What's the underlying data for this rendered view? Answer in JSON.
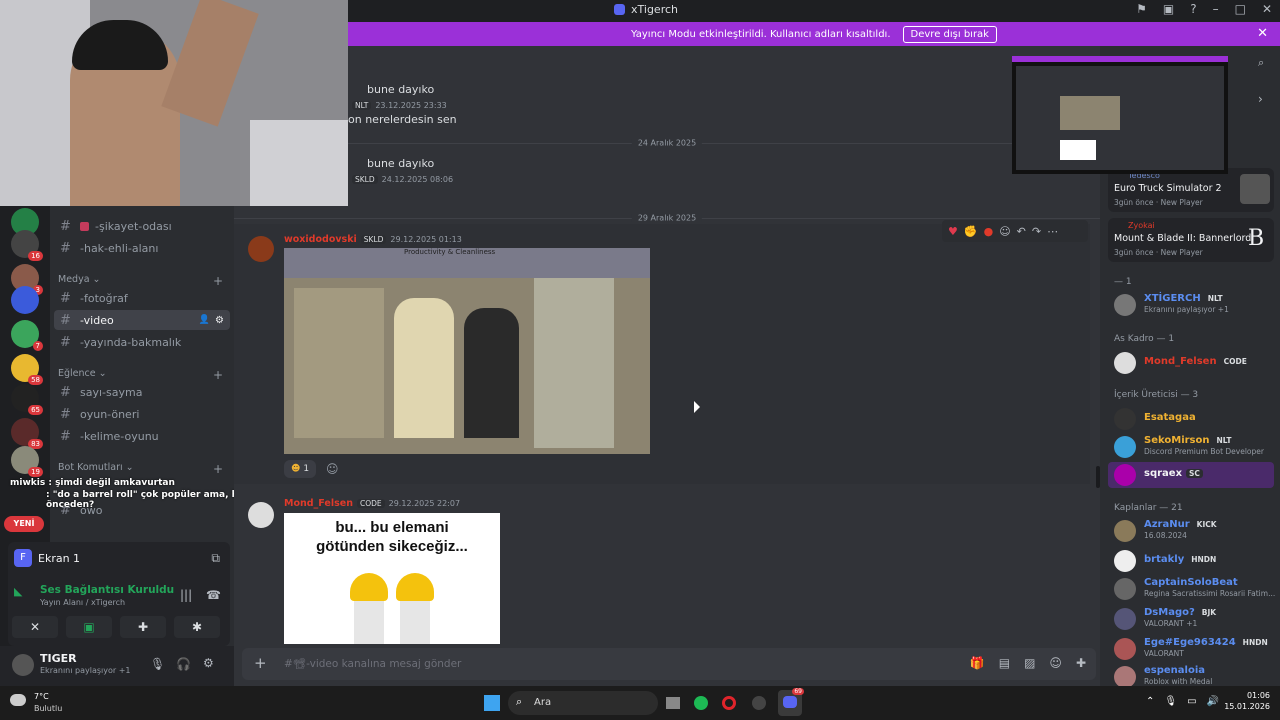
{
  "window": {
    "title": "xTigerch"
  },
  "banner": {
    "text": "Yayıncı Modu etkinleştirildi. Kullanıcı adları kısaltıldı.",
    "button": "Devre dışı bırak"
  },
  "sidebar": {
    "channels_top": [
      {
        "label": "-şikayet-odası"
      },
      {
        "label": "-hak-ehli-alanı"
      }
    ],
    "category_media": "Medya",
    "media": [
      {
        "label": "-fotoğraf"
      },
      {
        "label": "-video"
      },
      {
        "label": "-yayında-bakmalık"
      }
    ],
    "category_fun": "Eğlence",
    "fun": [
      {
        "label": "sayı-sayma"
      },
      {
        "label": "oyun-öneri"
      },
      {
        "label": "-kelime-oyunu"
      }
    ],
    "category_bot": "Bot Komutları",
    "bot": [
      {
        "label": "owo"
      }
    ]
  },
  "server_badges": [
    "16",
    "3",
    "7",
    "58",
    "65",
    "83",
    "19"
  ],
  "new_badge": "YENİ",
  "overlay_chat": [
    "miwkis : şimdi değil amkavurtan",
    ": \"do a barrel roll\" çok popüler ama, hiç görmedin mi önceden?"
  ],
  "voice": {
    "screen_label": "Ekran 1",
    "status": "Ses Bağlantısı Kuruldu",
    "sub": "Yayın Alanı",
    "sub2": "/ xTigerch"
  },
  "user": {
    "name": "TIGER",
    "status": "Ekranını paylaşıyor +1"
  },
  "chat": {
    "msg1_text": "bune dayıko",
    "msg1_tag": "NLT",
    "msg1_time": "23.12.2025 23:33",
    "msg2_text": "on nerelerdesin sen",
    "date1": "24 Aralık 2025",
    "msg3_text": "bune dayıko",
    "msg3_tag": "SKLD",
    "msg3_time": "24.12.2025 08:06",
    "date2": "29 Aralık 2025",
    "msg4_author": "woxidodovski",
    "msg4_tag": "SKLD",
    "msg4_time": "29.12.2025 01:13",
    "video_overlay": "Productivity & Cleanliness",
    "reaction_count": "1",
    "msg5_author": "Mond_Felsen",
    "msg5_tag": "CODE",
    "msg5_time": "29.12.2025 22:07",
    "meme_line1": "bu... bu elemani",
    "meme_line2": "götünden sikeceğiz..."
  },
  "composer": {
    "placeholder": "#📽-video kanalına mesaj gönder"
  },
  "members": {
    "activity1_user": "Tedesco",
    "activity1_game": "Euro Truck Simulator 2",
    "activity1_time": "3gün önce",
    "activity1_badge": "New Player",
    "activity2_user": "Zyokai",
    "activity2_game": "Mount & Blade II: Bannerlord",
    "activity2_time": "3gün önce",
    "activity2_badge": "New Player",
    "group1": "— 1",
    "m1_name": "XTİGERCH",
    "m1_tag": "NLT",
    "m1_status": "Ekranını paylaşıyor +1",
    "group2": "As Kadro — 1",
    "m2_name": "Mond_Felsen",
    "m2_tag": "CODE",
    "group3": "İçerik Üreticisi — 3",
    "m3_name": "Esatagaa",
    "m4_name": "SekoMirson",
    "m4_tag": "NLT",
    "m4_status": "Discord Premium Bot Developer",
    "m5_name": "sqraex",
    "m5_tag": "SC",
    "group4": "Kaplanlar — 21",
    "m6_name": "AzraNur",
    "m6_tag": "KICK",
    "m6_status": "16.08.2024",
    "m7_name": "brtakly",
    "m7_tag": "HNDN",
    "m8_name": "CaptainSoloBeat",
    "m8_status": "Regina Sacratissimi Rosarii Fatim...",
    "m9_name": "DsMago?",
    "m9_tag": "BJK",
    "m9_status": "VALORANT +1",
    "m10_name": "Ege#Ege963424",
    "m10_tag": "HNDN",
    "m10_status": "VALORANT",
    "m11_name": "espenaloia",
    "m11_status": "Roblox with Medal"
  },
  "taskbar": {
    "weather_temp": "7°C",
    "weather_desc": "Bulutlu",
    "search": "Ara",
    "time": "01:06",
    "date": "15.01.2026",
    "discord_badge": "69"
  }
}
